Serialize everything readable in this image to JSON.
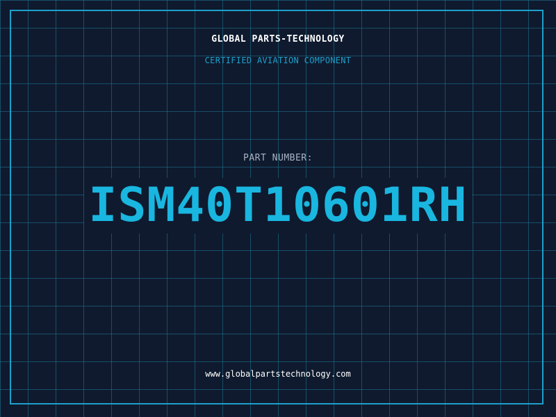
{
  "header": {
    "company": "GLOBAL PARTS-TECHNOLOGY",
    "subtitle": "CERTIFIED AVIATION COMPONENT"
  },
  "part": {
    "label": "PART NUMBER:",
    "number": "ISM40T10601RH"
  },
  "footer": {
    "website": "www.globalpartstechnology.com"
  },
  "colors": {
    "background": "#0f1a2e",
    "grid": "#1e7896",
    "accent": "#1ea0cc",
    "part_number": "#19b6e0",
    "label": "#a8b4c4",
    "text": "#ffffff"
  }
}
